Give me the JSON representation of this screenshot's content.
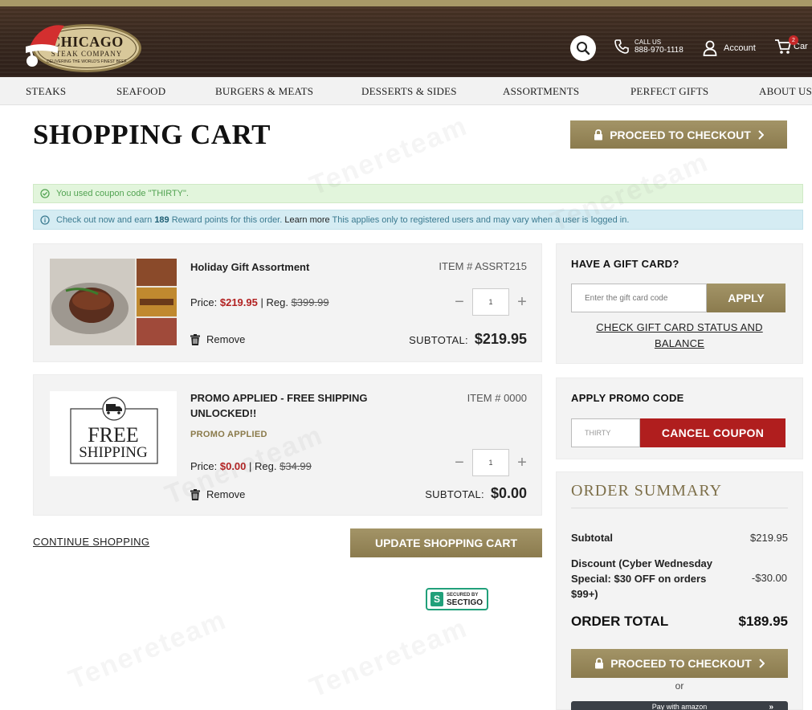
{
  "header": {
    "logo_line1": "CHICAGO",
    "logo_line2": "STEAK COMPANY",
    "logo_tagline": "DELIVERING THE WORLD'S FINEST BEEF",
    "call_label": "CALL US",
    "phone": "888-970-1118",
    "account_label": "Account",
    "cart_label": "Car",
    "cart_count": "2"
  },
  "nav": {
    "items": [
      "STEAKS",
      "SEAFOOD",
      "BURGERS & MEATS",
      "DESSERTS & SIDES",
      "ASSORTMENTS",
      "PERFECT GIFTS",
      "ABOUT US"
    ]
  },
  "page": {
    "title": "SHOPPING CART",
    "checkout_label": "PROCEED TO CHECKOUT"
  },
  "alerts": {
    "success": "You used coupon code \"THIRTY\".",
    "info_prefix": "Check out now and earn",
    "info_points": "189",
    "info_mid": "Reward points for this order.",
    "info_link": "Learn more",
    "info_suffix": "This applies only to registered users and may vary when a user is logged in."
  },
  "cart": {
    "items": [
      {
        "name": "Holiday Gift Assortment",
        "sku": "ITEM # ASSRT215",
        "price_label": "Price:",
        "price": "$219.95",
        "reg_label": "| Reg.",
        "reg_price": "$399.99",
        "qty": "1",
        "remove_label": "Remove",
        "subtotal_label": "SUBTOTAL:",
        "subtotal": "$219.95"
      },
      {
        "name": "PROMO APPLIED - FREE SHIPPING UNLOCKED!!",
        "sku": "ITEM # 0000",
        "badge": "PROMO APPLIED",
        "image_line1": "FREE",
        "image_line2": "SHIPPING",
        "price_label": "Price:",
        "price": "$0.00",
        "reg_label": "| Reg.",
        "reg_price": "$34.99",
        "qty": "1",
        "remove_label": "Remove",
        "subtotal_label": "SUBTOTAL:",
        "subtotal": "$0.00"
      }
    ],
    "continue_label": "CONTINUE SHOPPING",
    "update_label": "UPDATE SHOPPING CART",
    "secured_line1": "SECURED BY",
    "secured_line2": "SECTIGO"
  },
  "gift_card": {
    "heading": "HAVE A GIFT CARD?",
    "placeholder": "Enter the gift card code",
    "apply_label": "APPLY",
    "status_link": "CHECK GIFT CARD STATUS AND BALANCE"
  },
  "promo": {
    "heading": "APPLY PROMO CODE",
    "code_value": "THIRTY",
    "cancel_label": "CANCEL COUPON"
  },
  "summary": {
    "title": "ORDER SUMMARY",
    "subtotal_label": "Subtotal",
    "subtotal_value": "$219.95",
    "discount_label": "Discount (Cyber Wednesday Special: $30 OFF on orders $99+)",
    "discount_value": "-$30.00",
    "total_label": "ORDER TOTAL",
    "total_value": "$189.95",
    "checkout_label": "PROCEED TO CHECKOUT",
    "or_label": "or",
    "amazon_label": "Pay with amazon"
  },
  "colors": {
    "gold": "#8b7b4e",
    "sale_red": "#b22222",
    "cancel_red": "#b01e1e",
    "success_green": "#52a352",
    "info_blue": "#3b7a90"
  },
  "watermark": "Tenereteam"
}
